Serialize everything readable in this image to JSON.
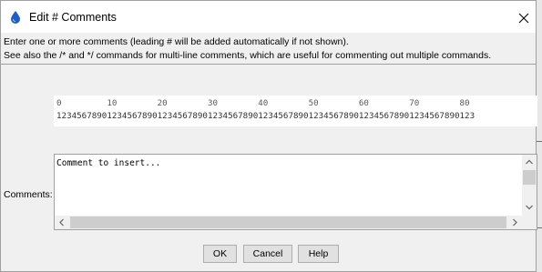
{
  "window": {
    "title": "Edit # Comments"
  },
  "info": {
    "line1": "Enter one or more comments (leading # will be added automatically if not shown).",
    "line2": "See also the /* and */ commands for multi-line comments, which are useful for commenting out multiple commands."
  },
  "ruler": {
    "tens": "0         10        20        30        40        50        60        70        80",
    "units": "12345678901234567890123456789012345678901234567890123456789012345678901234567890123"
  },
  "comments": {
    "label": "Comments:",
    "value": "Comment to insert..."
  },
  "buttons": {
    "ok": "OK",
    "cancel": "Cancel",
    "help": "Help"
  },
  "icons": {
    "app": "water-drop-icon",
    "close": "close-icon",
    "scroll_up": "chevron-up-icon",
    "scroll_down": "chevron-down-icon",
    "scroll_left": "chevron-left-icon",
    "scroll_right": "chevron-right-icon"
  },
  "colors": {
    "accent": "#1f5fbf",
    "dialog_bg": "#f0f0f0",
    "button_bg": "#e1e1e1"
  }
}
